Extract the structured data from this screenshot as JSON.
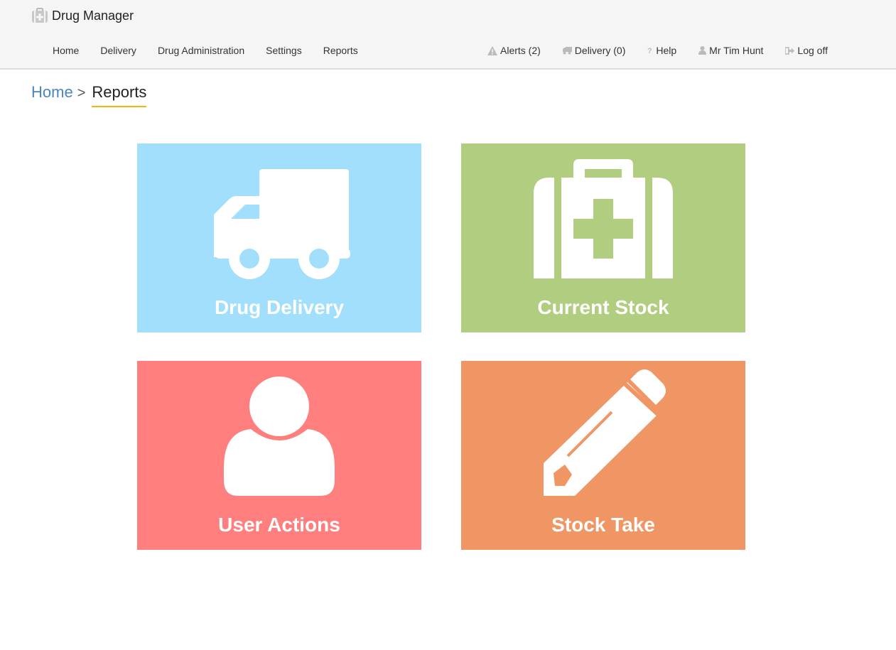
{
  "app": {
    "title": "Drug Manager",
    "brand_icon": "medical-kit-icon"
  },
  "nav": {
    "left": [
      "Home",
      "Delivery",
      "Drug Administration",
      "Settings",
      "Reports"
    ],
    "alerts": {
      "label": "Alerts (2)",
      "icon": "warning-icon"
    },
    "delivery": {
      "label": "Delivery (0)",
      "icon": "truck-icon"
    },
    "help": {
      "label": "Help",
      "icon": "question-icon"
    },
    "user": {
      "label": "Mr Tim Hunt",
      "icon": "user-icon"
    },
    "logoff": {
      "label": "Log off",
      "icon": "sign-out-icon"
    }
  },
  "breadcrumb": {
    "home": "Home",
    "separator": ">",
    "current": "Reports"
  },
  "tiles": [
    {
      "label": "Drug Delivery",
      "icon": "truck-icon",
      "color": "#a2dffd"
    },
    {
      "label": "Current Stock",
      "icon": "medical-kit-icon",
      "color": "#b1cd7f"
    },
    {
      "label": "User Actions",
      "icon": "user-icon",
      "color": "#ff7f7e"
    },
    {
      "label": "Stock Take",
      "icon": "pencil-icon",
      "color": "#ef9664"
    }
  ],
  "colors": {
    "link": "#4a86c5",
    "underline": "#f5b40a",
    "header_bg": "#f5f5f5",
    "icon_gray": "#bbbbbb"
  }
}
